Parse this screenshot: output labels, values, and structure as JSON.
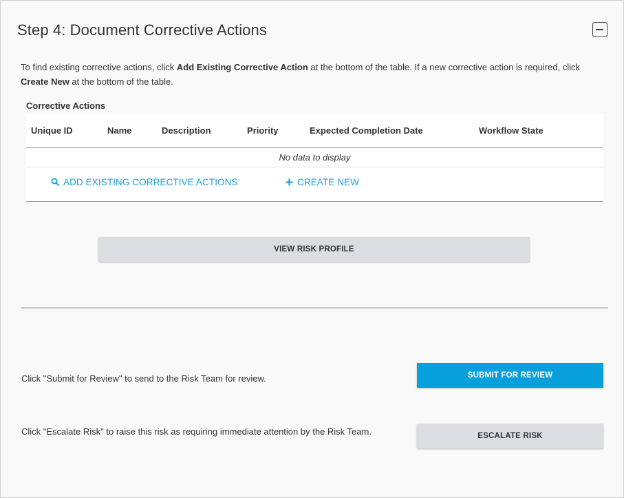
{
  "step": {
    "title": "Step 4: Document Corrective Actions",
    "collapse_icon": "minus-square-icon"
  },
  "intro": {
    "text_1": "To find existing corrective actions, click ",
    "bold_1": "Add Existing Corrective Action",
    "text_2": " at the bottom of the table. If a new corrective action is required, click ",
    "bold_2": "Create New",
    "text_3": " at the bottom of the table."
  },
  "corrective_actions": {
    "caption": "Corrective Actions",
    "columns": [
      "Unique ID",
      "Name",
      "Description",
      "Priority",
      "Expected Completion Date",
      "Workflow State"
    ],
    "empty_text": "No data to display",
    "add_existing_label": "ADD EXISTING CORRECTIVE ACTIONS",
    "create_new_label": "CREATE NEW"
  },
  "buttons": {
    "view_risk_profile": "VIEW RISK PROFILE",
    "submit_for_review": "SUBMIT FOR REVIEW",
    "escalate_risk": "ESCALATE RISK"
  },
  "notes": {
    "submit": "Click \"Submit for Review\" to send to the Risk Team for review.",
    "escalate": "Click \"Escalate Risk\" to raise this risk as requiring immediate attention by the Risk Team."
  },
  "colors": {
    "accent": "#079fdc",
    "link": "#1a9fd6",
    "button_grey": "#dcdde0"
  }
}
